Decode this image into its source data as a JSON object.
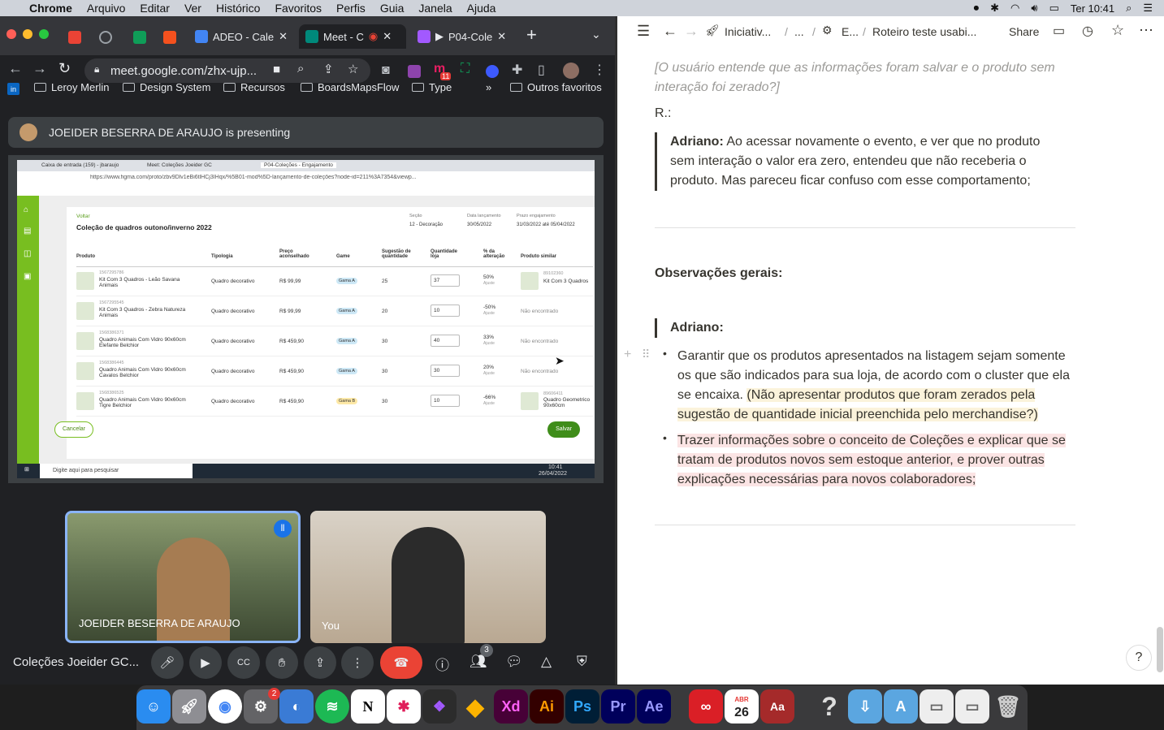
{
  "menubar": {
    "app": "Chrome",
    "items": [
      "Arquivo",
      "Editar",
      "Ver",
      "Histórico",
      "Favoritos",
      "Perfis",
      "Guia",
      "Janela",
      "Ajuda"
    ],
    "clock": "Ter 10:41"
  },
  "chrome": {
    "tabs": [
      {
        "label": "ADEO - Cale"
      },
      {
        "label": "Meet - C"
      },
      {
        "label": "P04-Cole"
      }
    ],
    "url": "meet.google.com/zhx-ujp...",
    "ext_badge": "11",
    "bookmarks": [
      "Leroy Merlin",
      "Design System",
      "Recursos",
      "BoardsMapsFlow",
      "Type",
      "Outros favoritos"
    ]
  },
  "meet": {
    "presenter_text": "JOEIDER BESERRA DE ARAUJO is presenting",
    "participants": [
      {
        "name": "JOEIDER BESERRA DE ARAUJO"
      },
      {
        "name": "You"
      }
    ],
    "meeting_title": "Coleções Joeider GC...",
    "participant_count": "3"
  },
  "shared": {
    "tabs": [
      "Caixa de entrada (159) - jbaraujo",
      "Meet: Coleções Joeider GC",
      "P04-Coleções - Engajamento"
    ],
    "url": "https://www.figma.com/proto/zbv9Dlv1eBi6tlHCj3IHqx/%5B01-mod%5D-lançamento-de-coleções?node-id=211%3A7354&viewp...",
    "back": "Voltar",
    "title": "Coleção de quadros outono/inverno 2022",
    "meta": [
      {
        "label": "Seção",
        "value": "12 - Decoração"
      },
      {
        "label": "Data lançamento",
        "value": "30/05/2022"
      },
      {
        "label": "Prazo engajamento",
        "value": "31/03/2022 até 05/04/2022"
      }
    ],
    "columns": [
      "Produto",
      "Tipologia",
      "Preço aconselhado",
      "Game",
      "Sugestão de quantidade",
      "Quantidade loja",
      "% da alteração",
      "Produto similar"
    ],
    "rows": [
      {
        "code": "1567295786",
        "name": "Kit Com 3 Quadros - Leão Savana Animais",
        "tipo": "Quadro decorativo",
        "preco": "R$ 99,99",
        "game": "Gama A",
        "sug": "25",
        "qty": "37",
        "pct": "50%",
        "adj": "Ajuste",
        "sim_code": "89102360",
        "sim": "Kit Com 3 Quadros"
      },
      {
        "code": "1567295545",
        "name": "Kit Com 3 Quadros - Zebra Natureza Animais",
        "tipo": "Quadro decorativo",
        "preco": "R$ 99,99",
        "game": "Gama A",
        "sug": "20",
        "qty": "10",
        "pct": "-50%",
        "adj": "Ajuste",
        "sim_code": "",
        "sim": "Não encontrado"
      },
      {
        "code": "1568386371",
        "name": "Quadro Animais Com Vidro 90x60cm Elefante Belchior",
        "tipo": "Quadro decorativo",
        "preco": "R$ 459,90",
        "game": "Gama A",
        "sug": "30",
        "qty": "40",
        "pct": "33%",
        "adj": "Ajuste",
        "sim_code": "",
        "sim": "Não encontrado"
      },
      {
        "code": "1568386445",
        "name": "Quadro Animais Com Vidro 90x60cm Cavalos Belchior",
        "tipo": "Quadro decorativo",
        "preco": "R$ 459,90",
        "game": "Gama A",
        "sug": "30",
        "qty": "30",
        "pct": "20%",
        "adj": "Ajuste",
        "sim_code": "",
        "sim": "Não encontrado"
      },
      {
        "code": "1568386525",
        "name": "Quadro Animais Com Vidro 90x60cm Tigre Belchior",
        "tipo": "Quadro decorativo",
        "preco": "R$ 459,90",
        "game": "Gama B",
        "sug": "30",
        "qty": "10",
        "pct": "-66%",
        "adj": "Ajuste",
        "sim_code": "89606411",
        "sim": "Quadro Geometrico 90x60cm"
      }
    ],
    "cancel": "Cancelar",
    "save": "Salvar",
    "taskbar_search": "Digite aqui para pesquisar",
    "taskbar_time": "10:41",
    "taskbar_date": "26/04/2022"
  },
  "notion": {
    "breadcrumb": [
      "Iniciativ...",
      "...",
      "E...",
      "Roteiro teste usabi..."
    ],
    "share": "Share",
    "question": "[O usuário entende que as informações foram salvar e o produto sem interação foi zerado?]",
    "answer_label": "R.:",
    "quote_name": "Adriano:",
    "quote_text": " Ao acessar novamente o evento, e ver que no produto sem interação o valor era zero, entendeu que não receberia o produto. Mas pareceu ficar confuso com esse comportamento;",
    "heading": "Observações gerais:",
    "sub_name": "Adriano:",
    "bullet1_a": "Garantir que os produtos apresentados na listagem sejam somente os que são indicados para sua loja, de acordo com o cluster que ela se encaixa.",
    "bullet1_b": "(Não apresentar produtos que foram zerados pela sugestão de quantidade inicial preenchida pelo merchandise?)",
    "bullet2": "Trazer informações sobre o conceito de Coleções e explicar que se tratam de produtos novos sem estoque anterior, e prover outras explicações necessárias para novos colaboradores;",
    "help": "?"
  },
  "dock": {
    "badge_settings": "2",
    "calendar_month": "ABR",
    "calendar_day": "26",
    "apps": [
      "Xd",
      "Ai",
      "Ps",
      "Pr",
      "Ae"
    ]
  },
  "colors": {
    "figma_green": "#78be20",
    "meet_red": "#ea4335",
    "notion_text": "#37352f",
    "highlight_yellow": "#fbf3db",
    "highlight_red": "#fbe4e4"
  }
}
